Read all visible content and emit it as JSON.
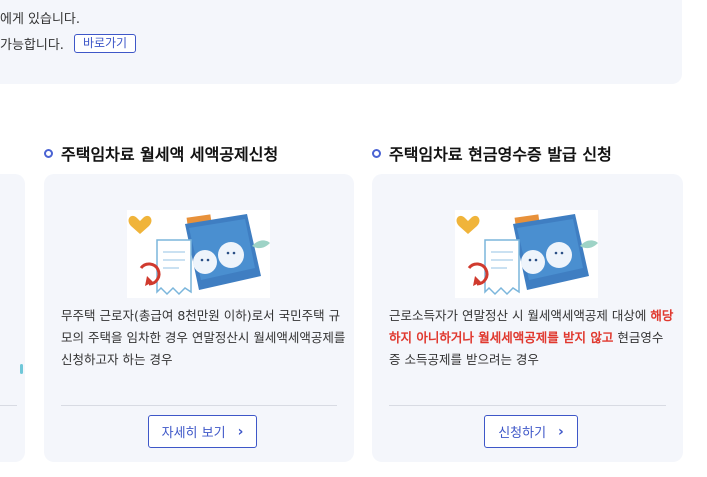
{
  "info": {
    "line1": "에게 있습니다.",
    "line2": "가능합니다.",
    "shortcut_label": "바로가기"
  },
  "sections": [
    {
      "title": "주택임차료 월세액 세액공제신청",
      "desc": "무주택 근로자(총급여 8천만원 이하)로서 국민주택 규모의 주택을 임차한 경우 연말정산시 월세액세액공제를 신청하고자 하는 경우",
      "button_label": "자세히 보기",
      "chevron": "›"
    },
    {
      "title": "주택임차료 현금영수증 발급 신청",
      "desc_before": "근로소득자가 연말정산 시 월세액세액공제 대상에 ",
      "desc_highlight": "해당하지 아니하거나 월세세액공제를 받지 않고",
      "desc_after": " 현금영수증 소득공제를 받으려는 경우",
      "button_label": "신청하기",
      "chevron": "›"
    }
  ],
  "colors": {
    "accent": "#3e57c8",
    "highlight": "#e0382e",
    "card_bg": "#f4f6fb"
  },
  "icons": {
    "section_bullet": "ring-bullet-icon",
    "illustration": "rent-receipt-illustration",
    "button_chevron": "chevron-right-icon"
  }
}
